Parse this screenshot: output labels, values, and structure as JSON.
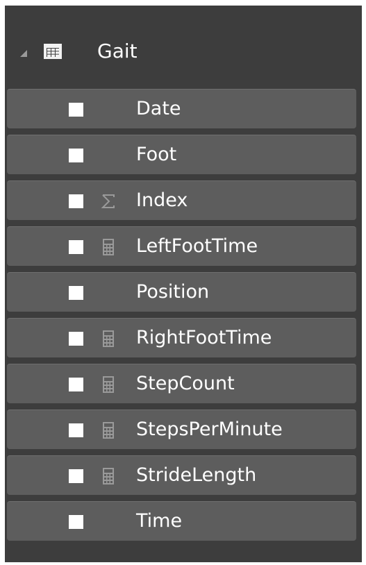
{
  "table": {
    "name": "Gait",
    "expanded": true,
    "icon": "table-icon"
  },
  "fields": [
    {
      "label": "Date",
      "checked": false,
      "type_icon": ""
    },
    {
      "label": "Foot",
      "checked": false,
      "type_icon": ""
    },
    {
      "label": "Index",
      "checked": false,
      "type_icon": "sigma-icon"
    },
    {
      "label": "LeftFootTime",
      "checked": false,
      "type_icon": "calculator-icon"
    },
    {
      "label": "Position",
      "checked": false,
      "type_icon": ""
    },
    {
      "label": "RightFootTime",
      "checked": false,
      "type_icon": "calculator-icon"
    },
    {
      "label": "StepCount",
      "checked": false,
      "type_icon": "calculator-icon"
    },
    {
      "label": "StepsPerMinute",
      "checked": false,
      "type_icon": "calculator-icon"
    },
    {
      "label": "StrideLength",
      "checked": false,
      "type_icon": "calculator-icon"
    },
    {
      "label": "Time",
      "checked": false,
      "type_icon": ""
    }
  ],
  "colors": {
    "panel_bg": "#3d3d3d",
    "row_bg": "#5d5d5d",
    "text": "#ffffff",
    "icon_gray": "#9a9a9a"
  }
}
